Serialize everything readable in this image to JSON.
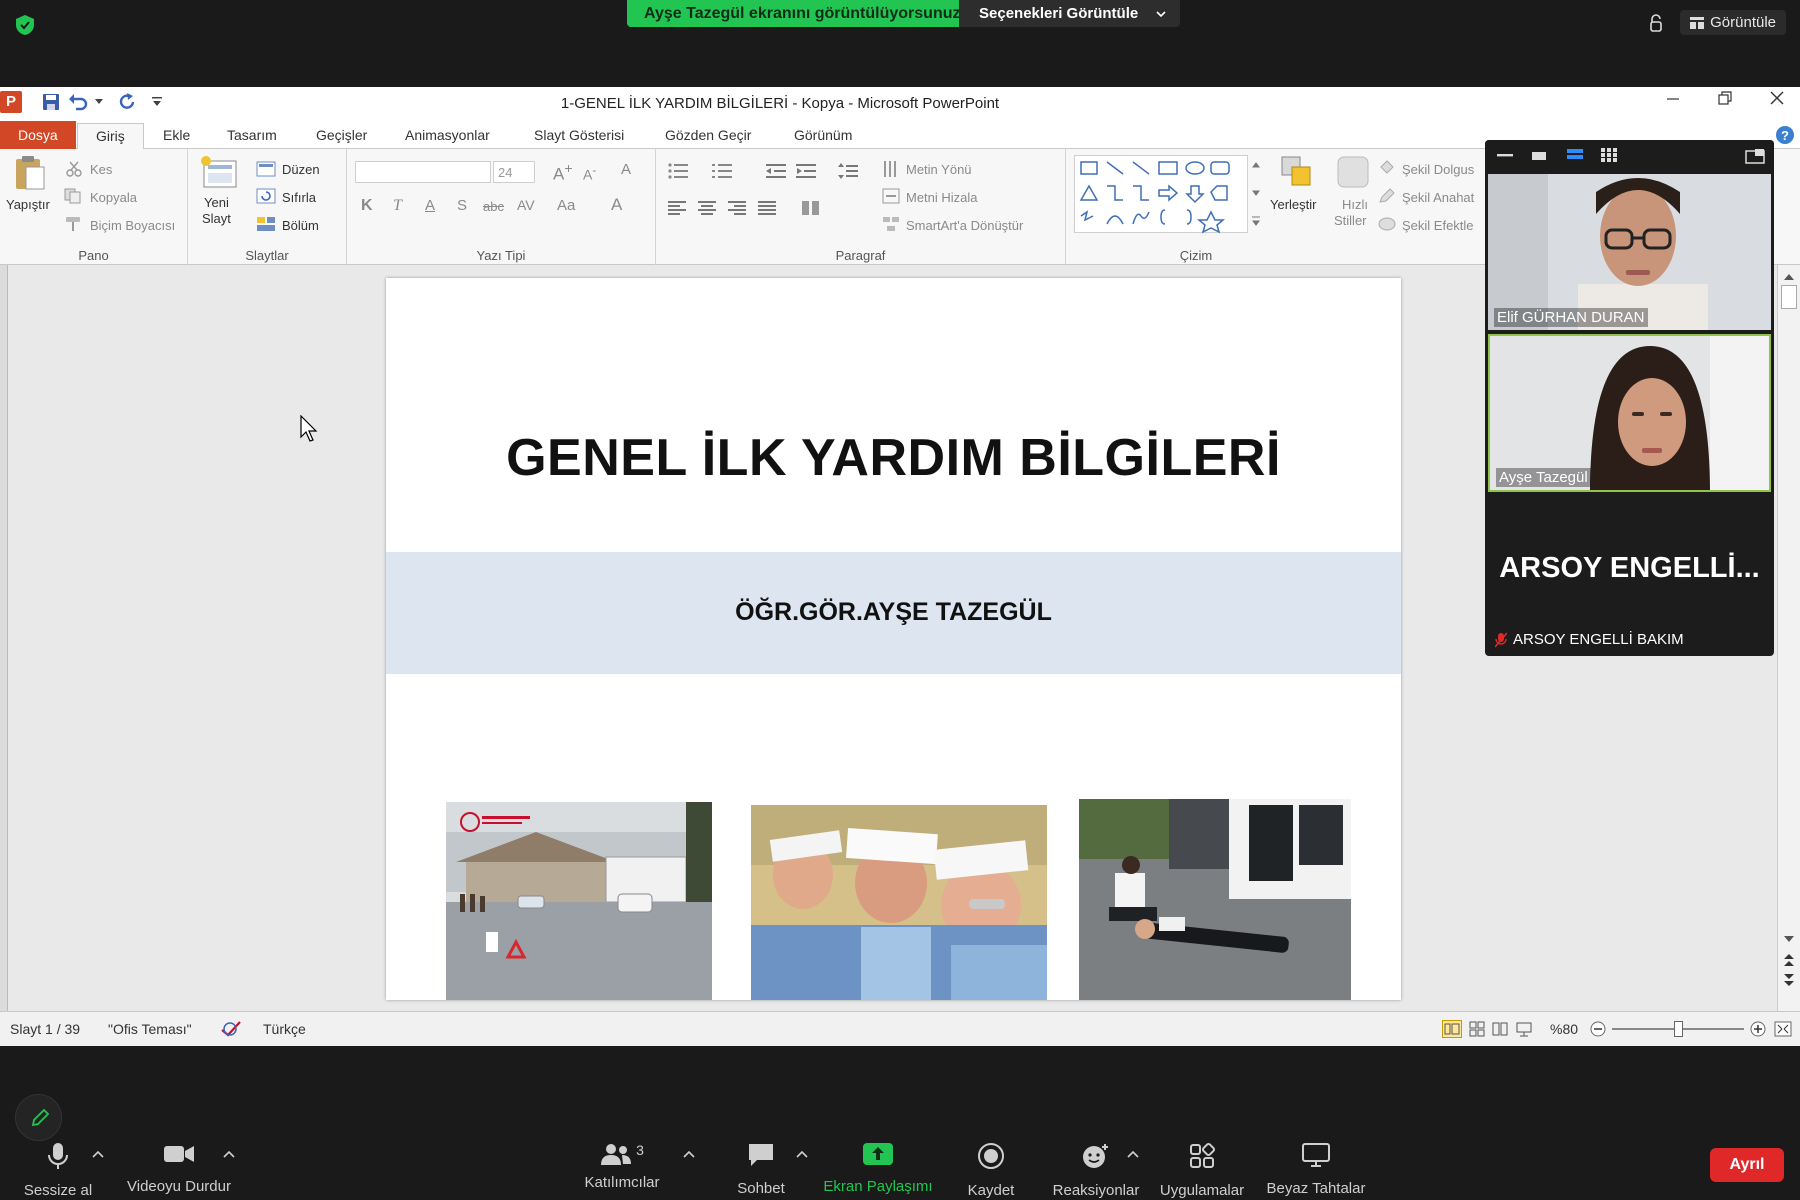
{
  "zoom_top": {
    "sharing_banner": "Ayşe Tazegül ekranını görüntülüyorsunuz",
    "view_options": "Seçenekleri Görüntüle",
    "view_button": "Görüntüle"
  },
  "window": {
    "title": "1-GENEL İLK YARDIM BİLGİLERİ - Kopya  -  Microsoft PowerPoint"
  },
  "tabs": [
    "Dosya",
    "Giriş",
    "Ekle",
    "Tasarım",
    "Geçişler",
    "Animasyonlar",
    "Slayt Gösterisi",
    "Gözden Geçir",
    "Görünüm"
  ],
  "ribbon": {
    "clipboard": {
      "paste": "Yapıştır",
      "cut": "Kes",
      "copy": "Kopyala",
      "format_painter": "Biçim Boyacısı",
      "label": "Pano"
    },
    "slides": {
      "new_slide_1": "Yeni",
      "new_slide_2": "Slayt",
      "layout": "Düzen",
      "reset": "Sıfırla",
      "section": "Bölüm",
      "label": "Slaytlar"
    },
    "font": {
      "size": "24",
      "label": "Yazı Tipi"
    },
    "paragraph": {
      "text_direction": "Metin Yönü",
      "align_text": "Metni Hizala",
      "smartart": "SmartArt'a Dönüştür",
      "label": "Paragraf"
    },
    "drawing": {
      "arrange": "Yerleştir",
      "quick_styles_1": "Hızlı",
      "quick_styles_2": "Stiller",
      "shape_fill": "Şekil Dolgus",
      "shape_outline": "Şekil Anahat",
      "shape_effects": "Şekil Efektle",
      "label": "Çizim"
    }
  },
  "slide": {
    "title": "GENEL İLK YARDIM BİLGİLERİ",
    "subtitle": "ÖĞR.GÖR.AYŞE TAZEGÜL"
  },
  "status": {
    "slide_counter": "Slayt 1 / 39",
    "theme": "\"Ofis Teması\"",
    "language": "Türkçe",
    "zoom": "%80",
    "zoom_level": 0.5
  },
  "participants": {
    "p1": "Elif GÜRHAN DURAN",
    "p2": "Ayşe Tazegül",
    "p3_big": "ARSOY  ENGELLİ...",
    "p3": "ARSOY ENGELLİ BAKIM"
  },
  "toolbar": {
    "mute": "Sessize al",
    "video": "Videoyu Durdur",
    "participants": "Katılımcılar",
    "participants_count": "3",
    "chat": "Sohbet",
    "share": "Ekran Paylaşımı",
    "record": "Kaydet",
    "reactions": "Reaksiyonlar",
    "apps": "Uygulamalar",
    "whiteboards": "Beyaz Tahtalar",
    "leave": "Ayrıl"
  },
  "colors": {
    "share_green": "#23c552",
    "file_tab": "#d24726",
    "leave_red": "#e02828",
    "slide_band": "#dde5f1"
  }
}
